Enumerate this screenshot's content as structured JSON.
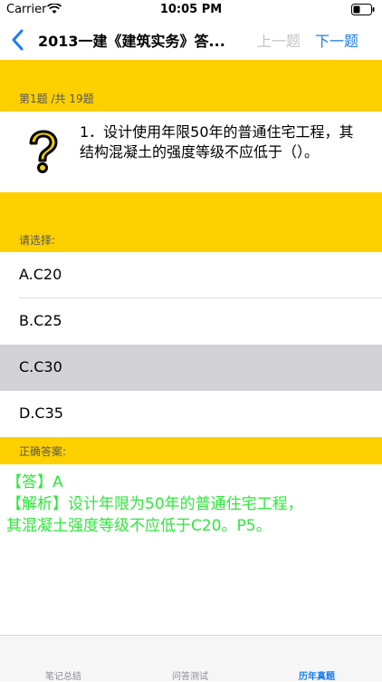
{
  "status": {
    "carrier": "Carrier",
    "time": "10:05 PM"
  },
  "nav": {
    "title": "2013一建《建筑实务》答...",
    "prev_label": "上一题",
    "next_label": "下一题"
  },
  "question": {
    "progress": "第1题 /共 19题",
    "text": "1．设计使用年限50年的普通住宅工程，其结构混凝土的强度等级不应低于（）。",
    "icon": "question-mark-icon"
  },
  "choices": {
    "header": "请选择:",
    "options": [
      {
        "label": "A.C20",
        "selected": false
      },
      {
        "label": "B.C25",
        "selected": false
      },
      {
        "label": "C.C30",
        "selected": true
      },
      {
        "label": "D.C35",
        "selected": false
      }
    ]
  },
  "answer": {
    "header": "正确答案:",
    "line1": "【答】A",
    "line2": "【解析】设计年限为50年的普通住宅工程，",
    "line3": "其混凝土强度等级不应低于C20。P5。",
    "color": "#2ee83a"
  },
  "tabs": [
    {
      "label": "笔记总结",
      "active": false
    },
    {
      "label": "问答测试",
      "active": false
    },
    {
      "label": "历年真题",
      "active": true
    }
  ],
  "colors": {
    "band": "#ffd000",
    "accent": "#1a7cf6",
    "selected_row": "#d1d1d6"
  }
}
